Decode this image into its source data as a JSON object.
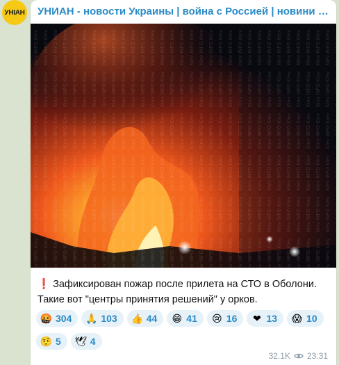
{
  "channel": {
    "avatar_text": "УНІАН",
    "title": "УНИАН - новости Украины | война с Россией | новини Україн..."
  },
  "post": {
    "watermark": "Kiev INFO",
    "caption_line1": "Зафиксирован пожар после прилета на СТО в Оболони.",
    "caption_line2": "Такие вот \"центры принятия решений\" у орков.",
    "alert_icon": "❗"
  },
  "reactions": [
    {
      "emoji": "🤬",
      "name": "angry-face-icon",
      "count": "304"
    },
    {
      "emoji": "🙏",
      "name": "praying-hands-icon",
      "count": "103"
    },
    {
      "emoji": "👍",
      "name": "thumbs-up-icon",
      "count": "44"
    },
    {
      "emoji": "😁",
      "name": "grinning-face-icon",
      "count": "41"
    },
    {
      "emoji": "😢",
      "name": "crying-face-icon",
      "count": "16"
    },
    {
      "emoji": "❤",
      "name": "red-heart-icon",
      "count": "13"
    },
    {
      "emoji": "😱",
      "name": "screaming-face-icon",
      "count": "10"
    },
    {
      "emoji": "🤨",
      "name": "raised-eyebrow-icon",
      "count": "5"
    },
    {
      "emoji": "🕊",
      "name": "dove-icon",
      "count": "4"
    }
  ],
  "meta": {
    "views": "32.1K",
    "time": "23:31"
  },
  "colors": {
    "accent": "#2a8bc6",
    "background": "#d9e3cf",
    "pill": "#e6f1f8"
  }
}
